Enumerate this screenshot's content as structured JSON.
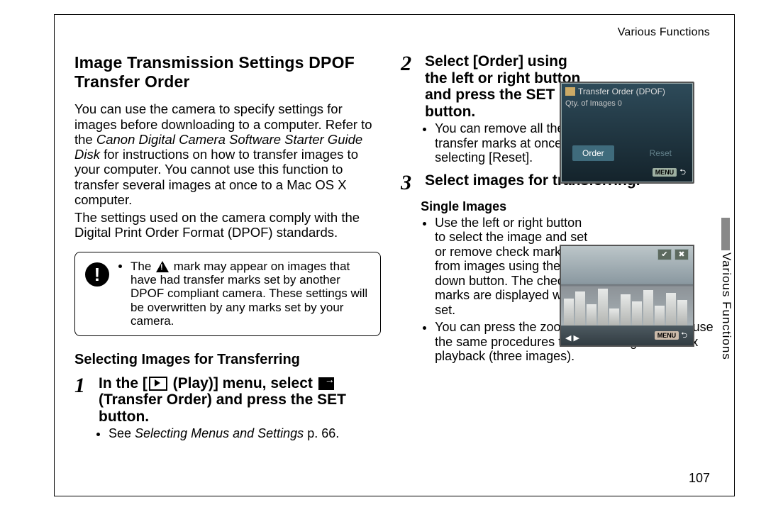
{
  "running_head": "Various Functions",
  "side_tab": "Various Functions",
  "page_number": "107",
  "left": {
    "title": "Image Transmission Settings DPOF Transfer Order",
    "p1a": "You can use the camera to specify settings for images before downloading to a computer. Refer to the ",
    "p1_italic": "Canon Digital Camera Software Starter Guide Disk",
    "p1b": " for instructions on how to transfer images to your computer. You cannot use this function to transfer several images at once to a Mac OS X computer.",
    "p2": "The settings used on the camera comply with the Digital Print Order Format (DPOF) standards.",
    "note_a": "The ",
    "note_b": " mark may appear on images that have had transfer marks set by another DPOF compliant camera. These settings will be overwritten by any marks set by your camera.",
    "sub_heading": "Selecting Images for Transferring",
    "step1_a": "In the [",
    "step1_b": " (Play)] menu, select ",
    "step1_c": " (Transfer Order) and press the SET button.",
    "step1_see_a": "See ",
    "step1_see_i": "Selecting Menus and Settings",
    "step1_see_b": " p. 66."
  },
  "right": {
    "step2_head": "Select [Order] using the left or right button and press the SET button.",
    "step2_bullet": "You can remove all the transfer marks at once by selecting [Reset].",
    "step3_head": "Select images for transferring.",
    "single_heading": "Single Images",
    "single_bullet1": "Use the left or right button to select the image and set or remove check marks from images using the up or down button. The check marks are displayed when set.",
    "single_bullet2_a": "You can press the zoom lever toward ",
    "single_bullet2_b": " and use the same procedures to select images in index playback (three images)."
  },
  "lcd": {
    "title": "Transfer Order (DPOF)",
    "qty": "Qty. of Images 0",
    "tab_order": "Order",
    "tab_reset": "Reset",
    "menu_icon": "MENU",
    "menu_arrow": "⮌"
  },
  "photo": {
    "check": "✔",
    "x": "✖",
    "menu_icon": "MENU",
    "menu_arrow": "⮌",
    "arrows": "◀  ▶"
  },
  "step_nums": {
    "s1": "1",
    "s2": "2",
    "s3": "3"
  }
}
